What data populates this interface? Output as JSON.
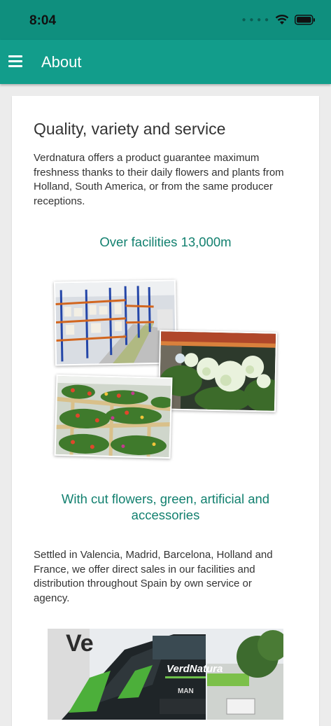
{
  "status_bar": {
    "time": "8:04",
    "icons": [
      "cellular-dots-icon",
      "wifi-icon",
      "battery-icon"
    ]
  },
  "app_bar": {
    "title": "About",
    "menu_icon": "hamburger-menu-icon",
    "color": "#129d8b"
  },
  "content": {
    "heading": "Quality, variety and service",
    "intro": "Verdnatura offers a product guarantee maximum freshness thanks to their daily flowers and plants from Holland, South America, or from the same producer receptions.",
    "facilities_caption": "Over facilities 13,000m",
    "cut_flowers_caption": "With cut flowers, green, artificial and accessories",
    "locations_text": "Settled in Valencia, Madrid, Barcelona, Holland and France, we offer direct sales in our facilities and distribution throughout Spain by own service or agency.",
    "truck_brand": "VerdNatura",
    "truck_make": "MAN",
    "building_sign": "Ve",
    "accent_color": "#12806f"
  }
}
